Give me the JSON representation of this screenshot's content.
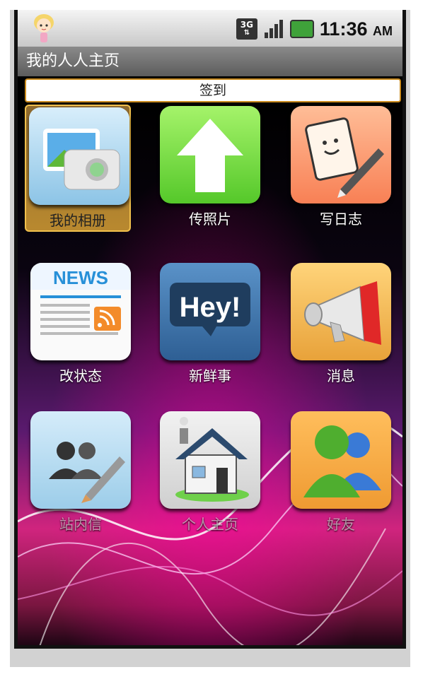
{
  "status_bar": {
    "network": "3G",
    "time": "11:36",
    "ampm": "AM"
  },
  "title_bar": {
    "title": "我的人人主页"
  },
  "signin_button": {
    "label": "签到"
  },
  "grid": {
    "items": [
      {
        "label": "我的相册",
        "icon": "photo-album-icon",
        "selected": true
      },
      {
        "label": "传照片",
        "icon": "upload-arrow-icon"
      },
      {
        "label": "写日志",
        "icon": "notepad-pen-icon"
      },
      {
        "label": "改状态",
        "icon": "news-feed-icon"
      },
      {
        "label": "新鲜事",
        "icon": "hey-speech-bubble-icon"
      },
      {
        "label": "消息",
        "icon": "megaphone-icon"
      },
      {
        "label": "站内信",
        "icon": "people-pen-icon"
      },
      {
        "label": "个人主页",
        "icon": "house-icon"
      },
      {
        "label": "好友",
        "icon": "friends-icon"
      }
    ]
  },
  "colors": {
    "selected_tile": "#b9892f",
    "upload_tile": "#7ee04a",
    "diary_tile": "#f89060",
    "hey_tile": "#3e73a8",
    "message_tile": "#f0b84e",
    "friends_tile": "#f0a040"
  }
}
